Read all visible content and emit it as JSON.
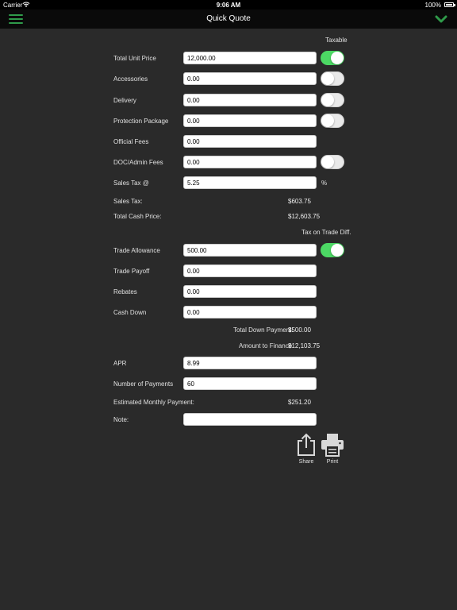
{
  "status": {
    "carrier": "Carrier",
    "time": "9:06 AM",
    "battery": "100%"
  },
  "nav": {
    "title": "Quick Quote"
  },
  "headers": {
    "taxable": "Taxable",
    "tax_on_trade": "Tax on Trade Diff."
  },
  "fields": {
    "total_unit_price": {
      "label": "Total Unit Price",
      "value": "12,000.00",
      "taxable": true
    },
    "accessories": {
      "label": "Accessories",
      "value": "0.00",
      "taxable": false
    },
    "delivery": {
      "label": "Delivery",
      "value": "0.00",
      "taxable": false
    },
    "protection_package": {
      "label": "Protection Package",
      "value": "0.00",
      "taxable": false
    },
    "official_fees": {
      "label": "Official Fees",
      "value": "0.00"
    },
    "doc_admin_fees": {
      "label": "DOC/Admin Fees",
      "value": "0.00",
      "taxable": false
    },
    "sales_tax_rate": {
      "label": "Sales Tax @",
      "value": "5.25",
      "unit": "%"
    },
    "trade_allowance": {
      "label": "Trade Allowance",
      "value": "500.00",
      "tax_on_trade": true
    },
    "trade_payoff": {
      "label": "Trade Payoff",
      "value": "0.00"
    },
    "rebates": {
      "label": "Rebates",
      "value": "0.00"
    },
    "cash_down": {
      "label": "Cash Down",
      "value": "0.00"
    },
    "apr": {
      "label": "APR",
      "value": "8.99"
    },
    "number_of_payments": {
      "label": "Number of Payments",
      "value": "60"
    },
    "note": {
      "label": "Note:",
      "value": ""
    }
  },
  "results": {
    "sales_tax": {
      "label": "Sales Tax:",
      "value": "$603.75"
    },
    "total_cash_price": {
      "label": "Total Cash Price:",
      "value": "$12,603.75"
    },
    "total_down_payment": {
      "label": "Total Down Payment:",
      "value": "$500.00"
    },
    "amount_to_finance": {
      "label": "Amount to Finance",
      "value": "$12,103.75"
    },
    "estimated_monthly_payment": {
      "label": "Estimated Monthly Payment:",
      "value": "$251.20"
    }
  },
  "actions": {
    "share": "Share",
    "print": "Print"
  },
  "colors": {
    "accent": "#2f9a4a",
    "toggle_on": "#4cd964",
    "background": "#2a2a2a"
  }
}
